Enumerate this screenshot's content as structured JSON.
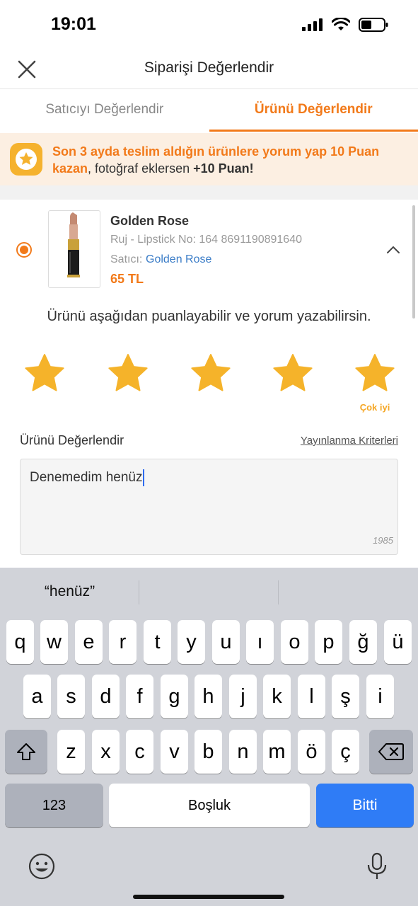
{
  "status_bar": {
    "time": "19:01"
  },
  "nav": {
    "title": "Siparişi Değerlendir",
    "close_icon": "close-icon"
  },
  "tabs": [
    {
      "label": "Satıcıyı Değerlendir",
      "active": false
    },
    {
      "label": "Ürünü Değerlendir",
      "active": true
    }
  ],
  "promo": {
    "highlight": "Son 3 ayda teslim aldığın ürünlere yorum yap 10 Puan kazan",
    "rest_plain": ", fotoğraf eklersen ",
    "rest_bold": "+10 Puan!",
    "icon": "star-badge-icon"
  },
  "product": {
    "name": "Golden Rose",
    "variant": "Ruj - Lipstick No: 164 8691190891640",
    "seller_label": "Satıcı:",
    "seller": "Golden Rose",
    "price": "65 TL",
    "selected": true
  },
  "rating": {
    "prompt": "Ürünü aşağıdan puanlayabilir ve yorum yazabilirsin.",
    "value": 5,
    "max": 5,
    "caption": "Çok iyi"
  },
  "review": {
    "label": "Ürünü Değerlendir",
    "criteria_link": "Yayınlanma Kriterleri",
    "text": "Denemedim henüz",
    "char_count": "1985"
  },
  "keyboard": {
    "suggestions": [
      "“henüz”",
      "",
      ""
    ],
    "row1": [
      "q",
      "w",
      "e",
      "r",
      "t",
      "y",
      "u",
      "ı",
      "o",
      "p",
      "ğ",
      "ü"
    ],
    "row2": [
      "a",
      "s",
      "d",
      "f",
      "g",
      "h",
      "j",
      "k",
      "l",
      "ş",
      "i"
    ],
    "row3": [
      "z",
      "x",
      "c",
      "v",
      "b",
      "n",
      "m",
      "ö",
      "ç"
    ],
    "numbers_label": "123",
    "space_label": "Boşluk",
    "done_label": "Bitti"
  },
  "colors": {
    "accent": "#f27a1a",
    "star": "#f5b32a",
    "link": "#3a7cc7",
    "done_key": "#2f7cf6"
  }
}
